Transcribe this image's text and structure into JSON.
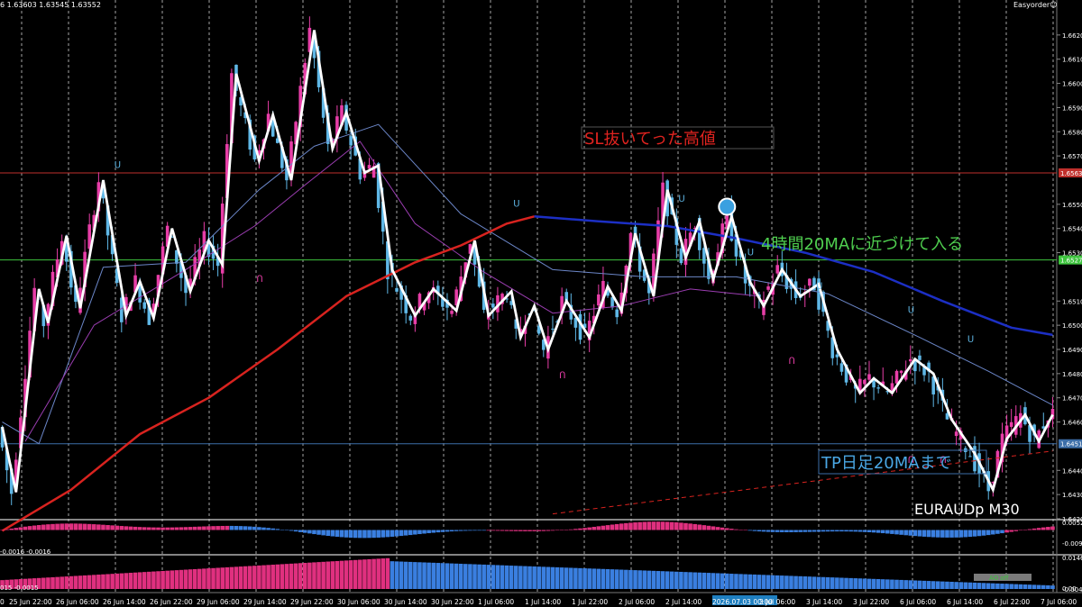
{
  "header": {
    "ohlc_text": "6 1.63603 1.63545 1.63552",
    "ea_label": "Easyorder☺"
  },
  "colors": {
    "bull": "#e83ea8",
    "bear": "#5fb7e6",
    "zigzag": "#ffffff",
    "ma_red": "#d8231f",
    "ma_blue": "#1c2fc4",
    "ma_thin_blue": "#6b86c8",
    "ma_thin_purple": "#9a3db0",
    "line_sl": "#c0302c",
    "line_entry": "#3ec43e",
    "line_tp": "#3c6ea8",
    "osc_pink": "#e0307f",
    "osc_blue": "#3a7fe0"
  },
  "annotations": {
    "sl": "SL抜いてった高値",
    "entry": "4時間20MAに近づけて入る",
    "tp": "TP日足20MAまで",
    "symbol": "EURAUDp M30"
  },
  "sub1": {
    "left_label": "-0.0016 -0.0016"
  },
  "sub2": {
    "left_label": "015 -0.0015",
    "ao_badge": "AO off"
  },
  "chart_data": {
    "type": "candlestick",
    "symbol": "EURAUDp",
    "timeframe": "M30",
    "ylim": [
      1.642,
      1.663
    ],
    "y_ticks": [
      {
        "v": 1.662,
        "label": "1.6620"
      },
      {
        "v": 1.661,
        "label": "1.6610"
      },
      {
        "v": 1.66,
        "label": "1.6600"
      },
      {
        "v": 1.659,
        "label": "1.6590"
      },
      {
        "v": 1.658,
        "label": "1.6580"
      },
      {
        "v": 1.657,
        "label": "1.6570"
      },
      {
        "v": 1.655,
        "label": "1.6550"
      },
      {
        "v": 1.654,
        "label": "1.6540"
      },
      {
        "v": 1.653,
        "label": "1.6530"
      },
      {
        "v": 1.651,
        "label": "1.6510"
      },
      {
        "v": 1.65,
        "label": "1.6500"
      },
      {
        "v": 1.649,
        "label": "1.6490"
      },
      {
        "v": 1.648,
        "label": "1.6480"
      },
      {
        "v": 1.647,
        "label": "1.6470"
      },
      {
        "v": 1.646,
        "label": "1.6460"
      },
      {
        "v": 1.644,
        "label": "1.6440"
      },
      {
        "v": 1.643,
        "label": "1.6430"
      },
      {
        "v": 1.642,
        "label": "1.6420"
      }
    ],
    "x_labels": [
      "25 Jun 22:00",
      "26 Jun 06:00",
      "26 Jun 14:00",
      "26 Jun 22:00",
      "29 Jun 06:00",
      "29 Jun 14:00",
      "29 Jun 22:00",
      "30 Jun 06:00",
      "30 Jun 14:00",
      "30 Jun 22:00",
      "1 Jul 06:00",
      "1 Jul 14:00",
      "1 Jul 22:00",
      "2 Jul 06:00",
      "2 Jul 14:00",
      "2026.07.03 00:00",
      "3 Jul 06:00",
      "3 Jul 14:00",
      "3 Jul 22:00",
      "6 Jul 06:00",
      "6 Jul 14:00",
      "6 Jul 22:00",
      "7 Jul 06:00"
    ],
    "x_first_partial": "0",
    "levels": [
      {
        "name": "sl_high",
        "value": 1.6563,
        "label": "1.6563",
        "color": "#c0302c"
      },
      {
        "name": "entry",
        "value": 1.6527,
        "label": "1.6527",
        "color": "#3ec43e"
      },
      {
        "name": "tp",
        "value": 1.6451,
        "label": "1.6451",
        "color": "#3c6ea8"
      }
    ],
    "zigzag": [
      {
        "x": 0,
        "y": 1.6458
      },
      {
        "x": 3,
        "y": 1.6431
      },
      {
        "x": 8,
        "y": 1.6515
      },
      {
        "x": 10,
        "y": 1.6501
      },
      {
        "x": 14,
        "y": 1.6537
      },
      {
        "x": 17,
        "y": 1.6507
      },
      {
        "x": 22,
        "y": 1.656
      },
      {
        "x": 27,
        "y": 1.6504
      },
      {
        "x": 30,
        "y": 1.6518
      },
      {
        "x": 33,
        "y": 1.6503
      },
      {
        "x": 37,
        "y": 1.654
      },
      {
        "x": 41,
        "y": 1.6514
      },
      {
        "x": 45,
        "y": 1.6535
      },
      {
        "x": 48,
        "y": 1.6525
      },
      {
        "x": 51,
        "y": 1.6604
      },
      {
        "x": 56,
        "y": 1.6568
      },
      {
        "x": 59,
        "y": 1.6587
      },
      {
        "x": 63,
        "y": 1.656
      },
      {
        "x": 68,
        "y": 1.6622
      },
      {
        "x": 72,
        "y": 1.6573
      },
      {
        "x": 75,
        "y": 1.6588
      },
      {
        "x": 79,
        "y": 1.6563
      },
      {
        "x": 82,
        "y": 1.6566
      },
      {
        "x": 85,
        "y": 1.6523
      },
      {
        "x": 90,
        "y": 1.6504
      },
      {
        "x": 94,
        "y": 1.6515
      },
      {
        "x": 99,
        "y": 1.6506
      },
      {
        "x": 103,
        "y": 1.6535
      },
      {
        "x": 106,
        "y": 1.6504
      },
      {
        "x": 111,
        "y": 1.6514
      },
      {
        "x": 113,
        "y": 1.6495
      },
      {
        "x": 116,
        "y": 1.6508
      },
      {
        "x": 119,
        "y": 1.649
      },
      {
        "x": 123,
        "y": 1.651
      },
      {
        "x": 128,
        "y": 1.6495
      },
      {
        "x": 132,
        "y": 1.6516
      },
      {
        "x": 135,
        "y": 1.6506
      },
      {
        "x": 138,
        "y": 1.6538
      },
      {
        "x": 142,
        "y": 1.6512
      },
      {
        "x": 145,
        "y": 1.6556
      },
      {
        "x": 149,
        "y": 1.6528
      },
      {
        "x": 152,
        "y": 1.6543
      },
      {
        "x": 155,
        "y": 1.6519
      },
      {
        "x": 159,
        "y": 1.6545
      },
      {
        "x": 163,
        "y": 1.6518
      },
      {
        "x": 166,
        "y": 1.6508
      },
      {
        "x": 170,
        "y": 1.6523
      },
      {
        "x": 174,
        "y": 1.6512
      },
      {
        "x": 178,
        "y": 1.6517
      },
      {
        "x": 182,
        "y": 1.649
      },
      {
        "x": 187,
        "y": 1.6472
      },
      {
        "x": 190,
        "y": 1.6478
      },
      {
        "x": 194,
        "y": 1.6472
      },
      {
        "x": 199,
        "y": 1.6486
      },
      {
        "x": 203,
        "y": 1.648
      },
      {
        "x": 207,
        "y": 1.6461
      },
      {
        "x": 212,
        "y": 1.6447
      },
      {
        "x": 216,
        "y": 1.6432
      },
      {
        "x": 219,
        "y": 1.6453
      },
      {
        "x": 223,
        "y": 1.6463
      },
      {
        "x": 226,
        "y": 1.6452
      },
      {
        "x": 229,
        "y": 1.6463
      }
    ],
    "ma_red": [
      {
        "x": 0,
        "y": 1.6415
      },
      {
        "x": 15,
        "y": 1.6432
      },
      {
        "x": 30,
        "y": 1.6455
      },
      {
        "x": 45,
        "y": 1.647
      },
      {
        "x": 60,
        "y": 1.649
      },
      {
        "x": 75,
        "y": 1.6512
      },
      {
        "x": 90,
        "y": 1.6526
      },
      {
        "x": 100,
        "y": 1.6533
      },
      {
        "x": 110,
        "y": 1.6542
      },
      {
        "x": 116,
        "y": 1.6545
      }
    ],
    "ma_blue": [
      {
        "x": 116,
        "y": 1.6545
      },
      {
        "x": 130,
        "y": 1.6543
      },
      {
        "x": 145,
        "y": 1.6541
      },
      {
        "x": 160,
        "y": 1.6536
      },
      {
        "x": 175,
        "y": 1.653
      },
      {
        "x": 190,
        "y": 1.6522
      },
      {
        "x": 205,
        "y": 1.651
      },
      {
        "x": 220,
        "y": 1.6499
      },
      {
        "x": 229,
        "y": 1.6496
      }
    ],
    "ma_thin_blue": [
      {
        "x": 0,
        "y": 1.646
      },
      {
        "x": 8,
        "y": 1.6451
      },
      {
        "x": 22,
        "y": 1.6524
      },
      {
        "x": 40,
        "y": 1.6526
      },
      {
        "x": 56,
        "y": 1.6556
      },
      {
        "x": 68,
        "y": 1.6574
      },
      {
        "x": 82,
        "y": 1.6583
      },
      {
        "x": 100,
        "y": 1.6546
      },
      {
        "x": 120,
        "y": 1.6523
      },
      {
        "x": 140,
        "y": 1.652
      },
      {
        "x": 160,
        "y": 1.652
      },
      {
        "x": 180,
        "y": 1.6513
      },
      {
        "x": 200,
        "y": 1.6495
      },
      {
        "x": 215,
        "y": 1.6481
      },
      {
        "x": 229,
        "y": 1.6467
      }
    ],
    "ma_thin_purple": [
      {
        "x": 5,
        "y": 1.6452
      },
      {
        "x": 20,
        "y": 1.65
      },
      {
        "x": 40,
        "y": 1.6523
      },
      {
        "x": 55,
        "y": 1.6541
      },
      {
        "x": 66,
        "y": 1.6558
      },
      {
        "x": 78,
        "y": 1.6576
      },
      {
        "x": 90,
        "y": 1.6542
      },
      {
        "x": 105,
        "y": 1.6522
      },
      {
        "x": 120,
        "y": 1.6505
      },
      {
        "x": 135,
        "y": 1.6508
      },
      {
        "x": 150,
        "y": 1.6515
      },
      {
        "x": 165,
        "y": 1.6512
      }
    ],
    "daily_ma_dashed": [
      {
        "x": 120,
        "y": 1.6422
      },
      {
        "x": 229,
        "y": 1.6448
      }
    ],
    "fractals_up": [
      {
        "x": 25,
        "y": 1.6565
      },
      {
        "x": 112,
        "y": 1.6549
      },
      {
        "x": 148,
        "y": 1.6551
      },
      {
        "x": 163,
        "y": 1.6529
      },
      {
        "x": 178,
        "y": 1.6515
      },
      {
        "x": 198,
        "y": 1.6505
      },
      {
        "x": 211,
        "y": 1.6493
      }
    ],
    "fractals_down": [
      {
        "x": 56,
        "y": 1.6518
      },
      {
        "x": 122,
        "y": 1.6478
      },
      {
        "x": 172,
        "y": 1.6484
      },
      {
        "x": 198,
        "y": 1.6443
      },
      {
        "x": 205,
        "y": 1.6443
      }
    ],
    "big_signal": {
      "x": 158,
      "y": 1.6549
    },
    "osc1_range": [
      -0.0095,
      0.0052
    ],
    "osc1_ticks": [
      {
        "v": 0.0052,
        "label": "0.0052"
      },
      {
        "v": -0.0095,
        "label": "-0.0095"
      }
    ],
    "osc2_range": [
      0,
      0.0146
    ],
    "osc2_ticks": [
      {
        "v": 0.0146,
        "label": "0.0146"
      },
      {
        "v": 0.0,
        "label": "0.00"
      },
      {
        "v": -0.0046,
        "label": "-0.0046"
      }
    ],
    "n_bars": 230
  }
}
